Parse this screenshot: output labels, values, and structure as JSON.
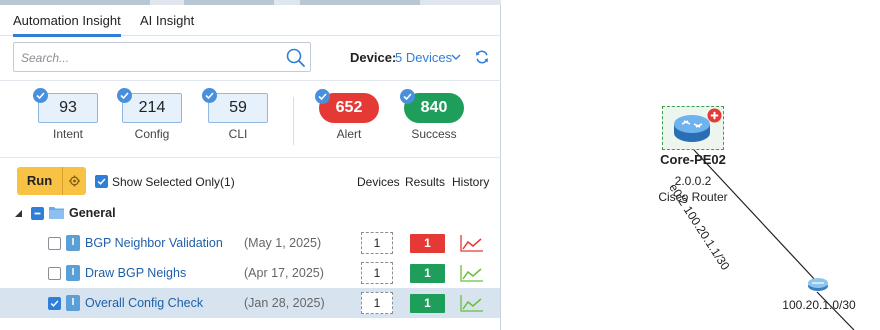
{
  "tabs": [
    {
      "label": "Automation Insight",
      "active": true
    },
    {
      "label": "AI Insight",
      "active": false
    }
  ],
  "search": {
    "placeholder": "Search...",
    "value": ""
  },
  "device_filter": {
    "label": "Device:",
    "value": "5 Devices"
  },
  "counters": [
    {
      "value": "93",
      "label": "Intent"
    },
    {
      "value": "214",
      "label": "Config"
    },
    {
      "value": "59",
      "label": "CLI"
    }
  ],
  "status": [
    {
      "value": "652",
      "label": "Alert",
      "color": "#e53935"
    },
    {
      "value": "840",
      "label": "Success",
      "color": "#1e9e5a"
    }
  ],
  "toolbar": {
    "run_label": "Run",
    "show_selected_label": "Show Selected Only(1)",
    "show_selected_checked": true
  },
  "columns": {
    "devices": "Devices",
    "results": "Results",
    "history": "History"
  },
  "group": {
    "name": "General"
  },
  "rows": [
    {
      "name": "BGP Neighbor Validation",
      "date": "(May 1, 2025)",
      "devices": "1",
      "result": "1",
      "result_color": "#e53935",
      "checked": false,
      "selected": false,
      "trend_color": "#e53935"
    },
    {
      "name": "Draw BGP Neighs",
      "date": "(Apr 17, 2025)",
      "devices": "1",
      "result": "1",
      "result_color": "#1e9e5a",
      "checked": false,
      "selected": false,
      "trend_color": "#6abf3a"
    },
    {
      "name": "Overall Config Check",
      "date": "(Jan 28, 2025)",
      "devices": "1",
      "result": "1",
      "result_color": "#1e9e5a",
      "checked": true,
      "selected": true,
      "trend_color": "#6abf3a"
    }
  ],
  "topology": {
    "node": {
      "name": "Core-PE02",
      "ip": "2.0.0.2",
      "type": "Cisco Router"
    },
    "link_label": "e0/2 100.20.1.1/30",
    "subnet_label": "100.20.1.0/30"
  }
}
